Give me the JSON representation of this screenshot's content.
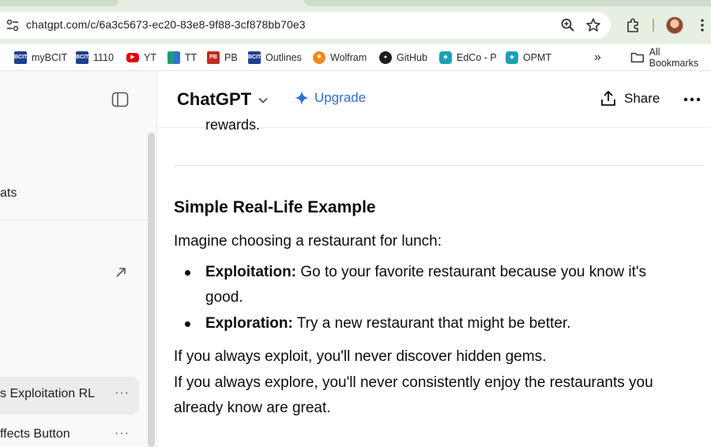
{
  "browser": {
    "url": "chatgpt.com/c/6a3c5673-ec20-83e8-9f88-3cf878bb70e3",
    "bookmarks": [
      {
        "label": "myBCIT",
        "icon": "bcit-icon"
      },
      {
        "label": "1110",
        "icon": "bcit-icon"
      },
      {
        "label": "YT",
        "icon": "youtube-icon"
      },
      {
        "label": "TT",
        "icon": "tt-icon"
      },
      {
        "label": "PB",
        "icon": "pb-icon"
      },
      {
        "label": "Outlines",
        "icon": "bcit-icon"
      },
      {
        "label": "Wolfram",
        "icon": "wolfram-icon"
      },
      {
        "label": "GitHub",
        "icon": "github-icon"
      },
      {
        "label": "EdCo - P",
        "icon": "edco-icon"
      },
      {
        "label": "OPMT",
        "icon": "edco-icon"
      }
    ],
    "overflow_label": "»",
    "all_bookmarks_label": "All Bookmarks"
  },
  "sidebar": {
    "chats_label_fragment": "ats",
    "items": [
      {
        "label": "s Exploitation RL",
        "menu": "···"
      },
      {
        "label": "ffects Button",
        "menu": "···"
      }
    ]
  },
  "header": {
    "title": "ChatGPT",
    "upgrade_label": "Upgrade",
    "share_label": "Share"
  },
  "content": {
    "clipped_line": "rewards.",
    "heading": "Simple Real-Life Example",
    "intro": "Imagine choosing a restaurant for lunch:",
    "bullets": [
      {
        "term": "Exploitation:",
        "line1": " Go to your favorite restaurant because you know it's",
        "line2": "good."
      },
      {
        "term": "Exploration:",
        "line1": " Try a new restaurant that might be better.",
        "line2": ""
      }
    ],
    "closing_1": "If you always exploit, you'll never discover hidden gems.",
    "closing_2": "If you always explore, you'll never consistently enjoy the restaurants you",
    "closing_3": "already know are great."
  },
  "colors": {
    "accent": "#2f6fd6",
    "chrome_bg": "#e7efe3"
  }
}
